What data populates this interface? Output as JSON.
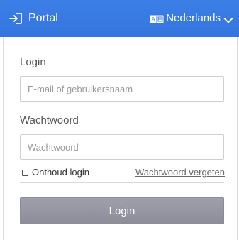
{
  "header": {
    "brand_icon": "sign-in-arrow-icon",
    "title": "Portal",
    "language_icon": "language-icon",
    "language_icon_text": "A 文",
    "language_label": "Nederlands",
    "language_chevron_icon": "chevron-down-icon",
    "background_color": "#3a7be0"
  },
  "form": {
    "login_label": "Login",
    "login_placeholder": "E-mail of gebruikersnaam",
    "login_value": "",
    "password_label": "Wachtwoord",
    "password_placeholder": "Wachtwoord",
    "password_value": "",
    "remember_label": "Onthoud login",
    "remember_checked": false,
    "forgot_link": "Wachtwoord vergeten",
    "submit_label": "Login",
    "submit_color": "#9796a3"
  }
}
